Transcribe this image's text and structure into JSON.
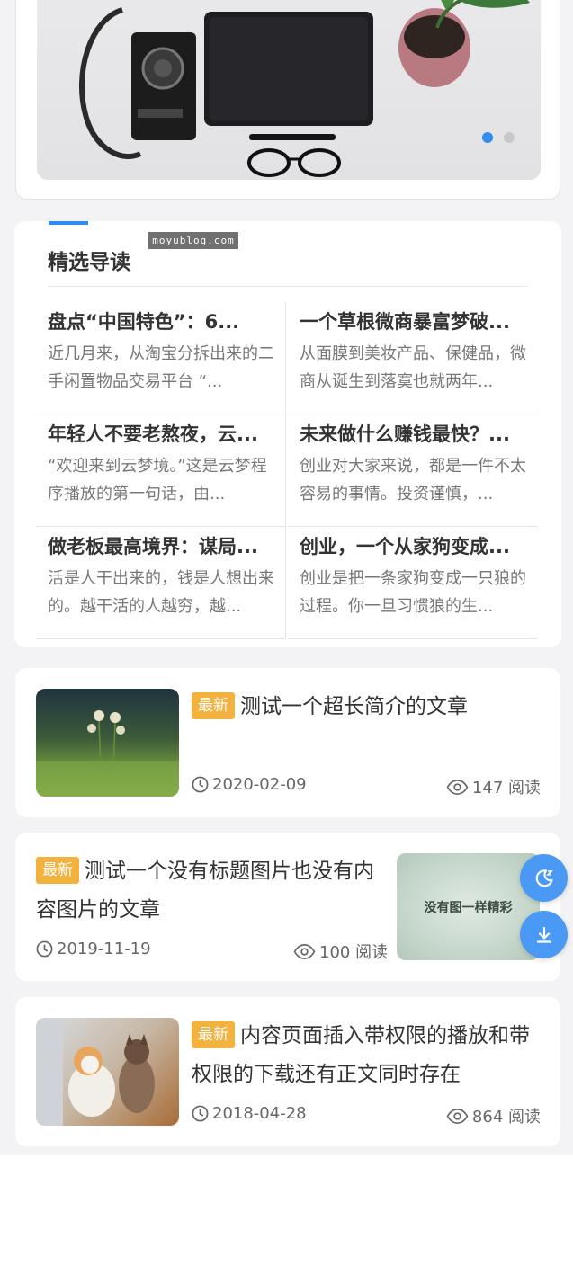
{
  "featured": {
    "title": "精选导读",
    "watermark": "moyublog.com",
    "items": [
      {
        "title": "盘点“中国特色”：6...",
        "desc": "近几月来，从淘宝分拆出来的二手闲置物品交易平台 “..."
      },
      {
        "title": "一个草根微商暴富梦破...",
        "desc": "从面膜到美妆产品、保健品，微商从诞生到落寞也就两年..."
      },
      {
        "title": "年轻人不要老熬夜，云...",
        "desc": "“欢迎来到云梦境。”这是云梦程序播放的第一句话，由..."
      },
      {
        "title": "未来做什么赚钱最快？...",
        "desc": "创业对大家来说，都是一件不太容易的事情。投资谨慎，..."
      },
      {
        "title": "做老板最高境界：谋局...",
        "desc": "活是人干出来的，钱是人想出来的。越干活的人越穷，越..."
      },
      {
        "title": "创业，一个从家狗变成...",
        "desc": "创业是把一条家狗变成一只狼的过程。你一旦习惯狼的生..."
      }
    ]
  },
  "articles": [
    {
      "badge": "最新",
      "title": "测试一个超长简介的文章",
      "date": "2020-02-09",
      "views": "147 阅读"
    },
    {
      "badge": "最新",
      "title": "测试一个没有标题图片也没有内容图片的文章",
      "date": "2019-11-19",
      "views": "100 阅读",
      "placeholder_text": "没有图一样精彩"
    },
    {
      "badge": "最新",
      "title": "内容页面插入带权限的播放和带权限的下载还有正文同时存在",
      "date": "2018-04-28",
      "views": "864 阅读"
    }
  ],
  "colors": {
    "accent": "#2f8cf0",
    "badge": "#f2b23d",
    "fab": "#4a9af5"
  },
  "icons": {
    "date": "clock-icon",
    "views": "eye-icon",
    "fab_top": "moon-icon",
    "fab_bottom": "download-icon"
  }
}
